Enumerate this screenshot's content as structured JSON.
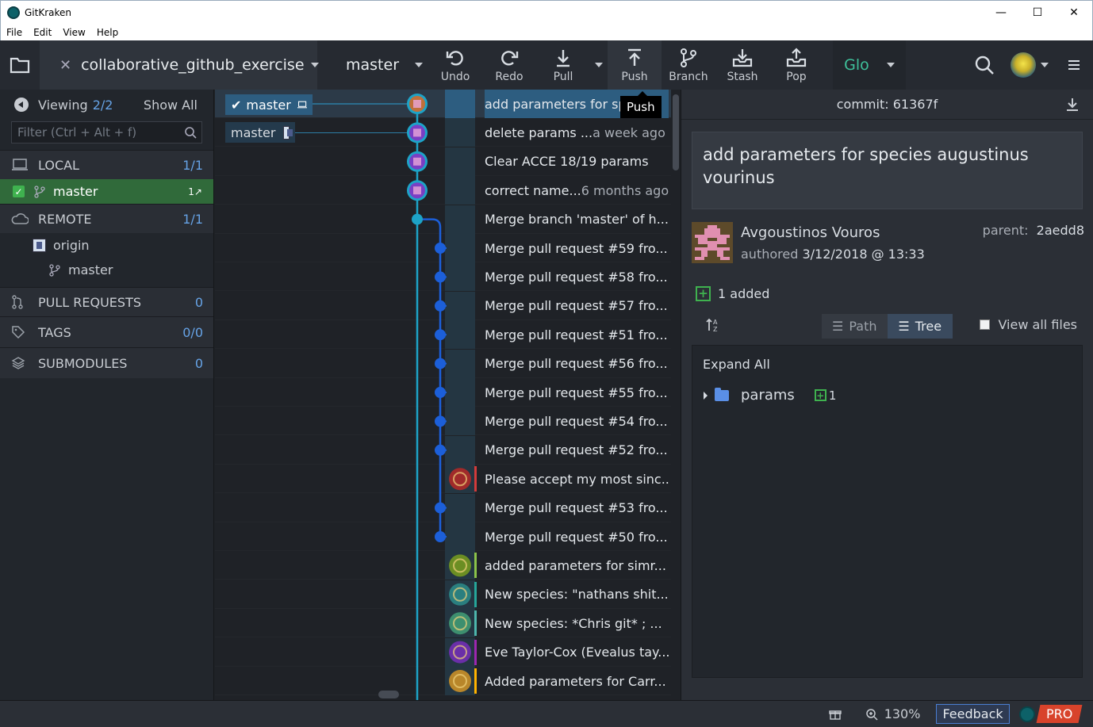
{
  "window": {
    "title": "GitKraken",
    "minimize": "—",
    "maximize": "☐",
    "close": "✕"
  },
  "menu": [
    "File",
    "Edit",
    "View",
    "Help"
  ],
  "toolbar": {
    "repo": "collaborative_github_exercise",
    "branch": "master",
    "buttons": {
      "undo": "Undo",
      "redo": "Redo",
      "pull": "Pull",
      "push": "Push",
      "branch": "Branch",
      "stash": "Stash",
      "pop": "Pop"
    },
    "glo": "Glo"
  },
  "tooltip": "Push",
  "left": {
    "viewing_label": "Viewing",
    "viewing_count": "2/2",
    "show_all": "Show All",
    "filter_placeholder": "Filter (Ctrl + Alt + f)",
    "local": {
      "label": "LOCAL",
      "count": "1/1"
    },
    "local_branch": {
      "name": "master",
      "badge": "1↗"
    },
    "remote": {
      "label": "REMOTE",
      "count": "1/1"
    },
    "remote_origin": "origin",
    "remote_branch": "master",
    "pull_requests": {
      "label": "PULL REQUESTS",
      "count": "0"
    },
    "tags": {
      "label": "TAGS",
      "count": "0/0"
    },
    "submodules": {
      "label": "SUBMODULES",
      "count": "0"
    }
  },
  "graph": {
    "ref_local": "master",
    "ref_remote": "master",
    "commits": [
      {
        "msg": "add parameters for spe",
        "when": ""
      },
      {
        "msg": "delete params ...",
        "when": "a week ago"
      },
      {
        "msg": "Clear ACCE 18/19 params",
        "when": ""
      },
      {
        "msg": "correct name...",
        "when": "6 months ago"
      },
      {
        "msg": "Merge branch 'master' of h...",
        "when": ""
      },
      {
        "msg": "Merge pull request #59 fro...",
        "when": ""
      },
      {
        "msg": "Merge pull request #58 fro...",
        "when": ""
      },
      {
        "msg": "Merge pull request #57 fro...",
        "when": ""
      },
      {
        "msg": "Merge pull request #51 fro...",
        "when": ""
      },
      {
        "msg": "Merge pull request #56 fro...",
        "when": ""
      },
      {
        "msg": "Merge pull request #55 fro...",
        "when": ""
      },
      {
        "msg": "Merge pull request #54 fro...",
        "when": ""
      },
      {
        "msg": "Merge pull request #52 fro...",
        "when": ""
      },
      {
        "msg": "Please accept my most sinc...",
        "when": ""
      },
      {
        "msg": "Merge pull request #53 fro...",
        "when": ""
      },
      {
        "msg": "Merge pull request #50 fro...",
        "when": ""
      },
      {
        "msg": "added parameters for simr...",
        "when": ""
      },
      {
        "msg": "New species: \"nathans shit...",
        "when": ""
      },
      {
        "msg": "New species: *Chris git* ; ...",
        "when": ""
      },
      {
        "msg": "Eve Taylor-Cox (Evealus tay...",
        "when": ""
      },
      {
        "msg": "Added parameters for Carr...",
        "when": ""
      }
    ]
  },
  "detail": {
    "commit_label": "commit:",
    "commit_sha": "61367f",
    "message": "add parameters for species augustinus vourinus",
    "author": "Avgoustinos Vouros",
    "authored_label": "authored",
    "authored_date": "3/12/2018 @ 13:33",
    "parent_label": "parent:",
    "parent_sha": "2aedd8",
    "added": "1 added",
    "path_label": "Path",
    "tree_label": "Tree",
    "view_all": "View all files",
    "expand_all": "Expand All",
    "folder": "params",
    "folder_added": "1"
  },
  "status": {
    "zoom": "130%",
    "feedback": "Feedback",
    "pro": "PRO"
  }
}
